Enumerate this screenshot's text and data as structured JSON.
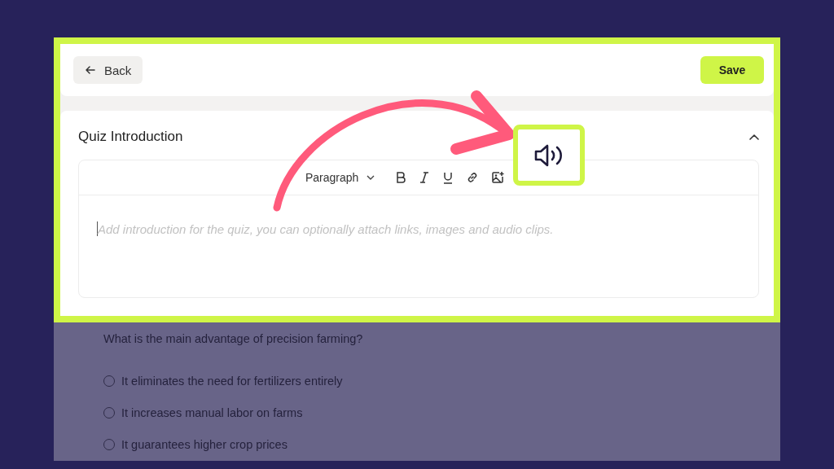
{
  "header": {
    "back_button": "Back",
    "save_button": "Save"
  },
  "section": {
    "title": "Quiz Introduction",
    "expanded": true,
    "editor": {
      "block_style": "Paragraph",
      "placeholder": "Add introduction for the quiz, you can optionally attach links, images and audio clips."
    }
  },
  "question": {
    "text": "What is the main advantage of precision farming?",
    "options": [
      {
        "label": "It eliminates the need for fertilizers entirely",
        "selected": false
      },
      {
        "label": "It increases manual labor on farms",
        "selected": false
      },
      {
        "label": "It guarantees higher crop prices",
        "selected": false
      }
    ]
  }
}
